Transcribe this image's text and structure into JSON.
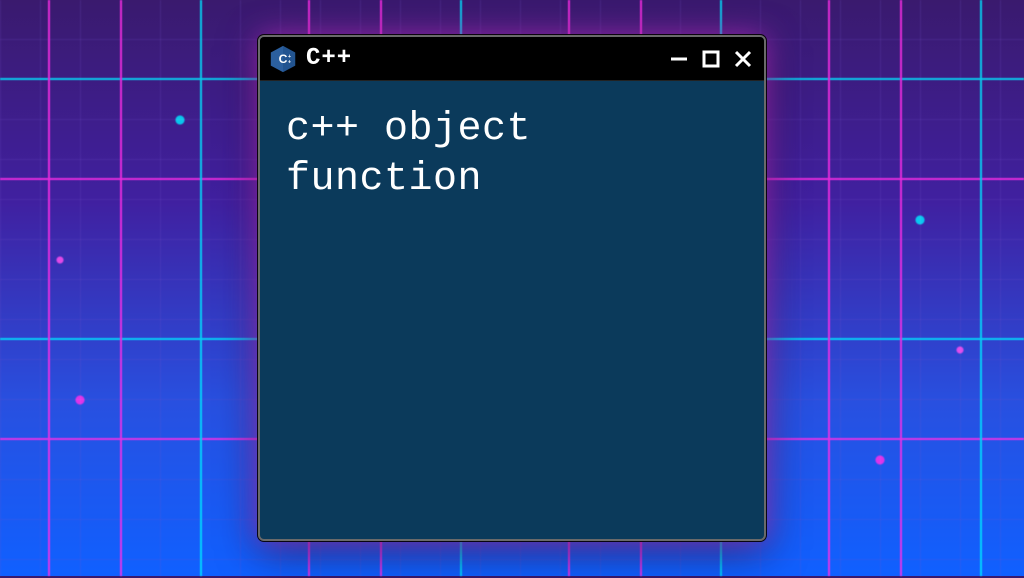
{
  "window": {
    "title": "C++",
    "icon_name": "cpp-logo-icon",
    "controls": {
      "minimize": "minimize",
      "maximize": "maximize",
      "close": "close"
    }
  },
  "content": {
    "text": "c++ object\nfunction"
  },
  "colors": {
    "window_bg": "#0b3a5b",
    "titlebar_bg": "#000000",
    "glow": "#ff3cff",
    "neon_pink": "#ff2ee8",
    "neon_cyan": "#00e5ff"
  }
}
